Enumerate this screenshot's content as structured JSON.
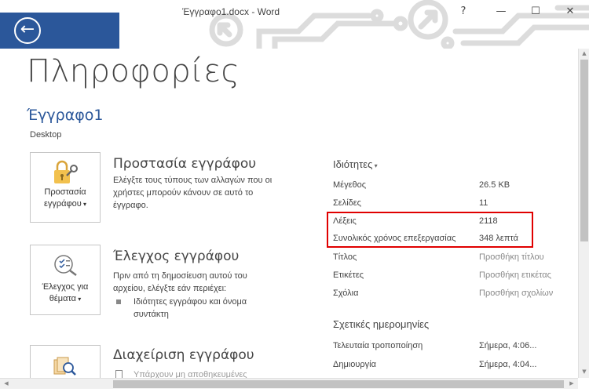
{
  "window": {
    "title": "Έγγραφο1.docx  -  Word",
    "help": "?",
    "minimize": "—",
    "maximize": "☐",
    "close": "✕"
  },
  "back_button": {
    "icon": "back-arrow-icon",
    "glyph": "←"
  },
  "page_title": "Πληροφορίες",
  "document": {
    "name": "Έγγραφο1",
    "location": "Desktop"
  },
  "sections": [
    {
      "button_line1": "Προστασία",
      "button_line2": "εγγράφου",
      "title": "Προστασία εγγράφου",
      "description": "Ελέγξτε τους τύπους των αλλαγών που οι χρήστες μπορούν κάνουν σε αυτό το έγγραφο."
    },
    {
      "button_line1": "Έλεγχος για",
      "button_line2": "θέματα",
      "title": "Έλεγχος εγγράφου",
      "description": "Πριν από τη δημοσίευση αυτού του αρχείου, ελέγξτε εάν περιέχει:",
      "bullet": "Ιδιότητες εγγράφου και όνομα συντάκτη"
    },
    {
      "title": "Διαχείριση εγγράφου",
      "description": "Υπάρχουν μη αποθηκευμένες"
    }
  ],
  "properties": {
    "header": "Ιδιότητες",
    "rows": [
      {
        "key": "Μέγεθος",
        "value": "26.5 KB"
      },
      {
        "key": "Σελίδες",
        "value": "11"
      },
      {
        "key": "Λέξεις",
        "value": "2118"
      },
      {
        "key": "Συνολικός χρόνος επεξεργασίας",
        "value": "348 λεπτά"
      },
      {
        "key": "Τίτλος",
        "value": "Προσθήκη τίτλου"
      },
      {
        "key": "Ετικέτες",
        "value": "Προσθήκη ετικέτας"
      },
      {
        "key": "Σχόλια",
        "value": "Προσθήκη σχολίων"
      }
    ]
  },
  "dates": {
    "header": "Σχετικές ημερομηνίες",
    "rows": [
      {
        "key": "Τελευταία τροποποίηση",
        "value": "Σήμερα, 4:06..."
      },
      {
        "key": "Δημιουργία",
        "value": "Σήμερα, 4:04..."
      }
    ]
  },
  "colors": {
    "accent": "#2b579a",
    "highlight": "#e00000"
  }
}
